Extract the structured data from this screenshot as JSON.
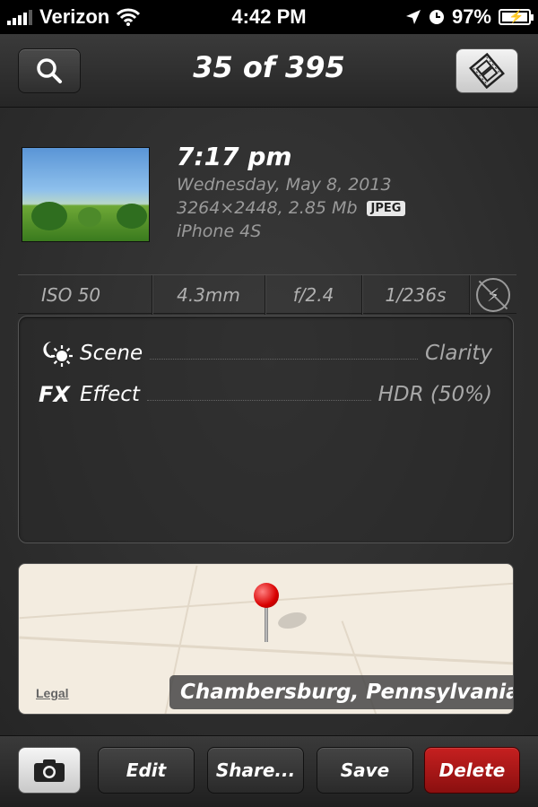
{
  "status_bar": {
    "carrier": "Verizon",
    "time": "4:42 PM",
    "battery_percent": "97%",
    "icons": [
      "signal-bars-icon",
      "wifi-icon",
      "location-arrow-icon",
      "clock-icon",
      "battery-charging-icon"
    ]
  },
  "header": {
    "title": "35 of 395",
    "left_icon": "search-icon",
    "right_icon": "film-strip-icon"
  },
  "photo": {
    "time": "7:17 pm",
    "date": "Wednesday, May 8, 2013",
    "resolution_size": "3264×2448, 2.85 Mb",
    "format": "JPEG",
    "device": "iPhone 4S"
  },
  "exif": {
    "iso": "ISO 50",
    "focal_length": "4.3mm",
    "aperture": "f/2.4",
    "shutter": "1/236s",
    "flash_icon": "no-flash-icon"
  },
  "details": [
    {
      "label": "Scene",
      "value": "Clarity",
      "icon": "moon-sun-icon"
    },
    {
      "label": "Effect",
      "value": "HDR (50%)",
      "icon_text": "FX"
    }
  ],
  "map": {
    "legal": "Legal",
    "location": "Chambersburg, Pennsylvania"
  },
  "toolbar": {
    "edit": "Edit",
    "share": "Share...",
    "save": "Save",
    "delete": "Delete",
    "camera_icon": "camera-icon",
    "delete_color": "#b51616"
  }
}
